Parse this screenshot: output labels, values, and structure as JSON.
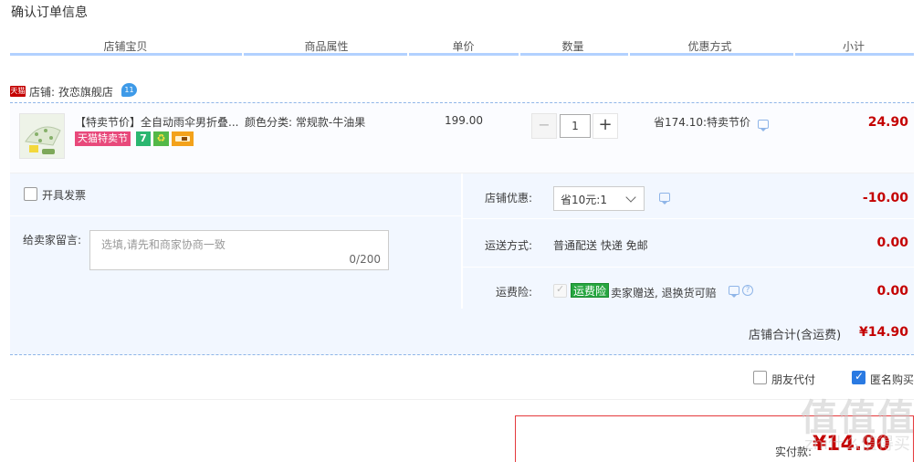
{
  "page_title": "确认订单信息",
  "columns": [
    "店铺宝贝",
    "商品属性",
    "单价",
    "数量",
    "优惠方式",
    "小计"
  ],
  "shop": {
    "badge": "天猫",
    "label": "店铺: 孜恋旗舰店",
    "chat_badge": "11"
  },
  "item": {
    "title": "【特卖节价】全自动雨伞男折叠...",
    "tag_sale": "天猫特卖节",
    "tag_seven": "7",
    "tag_shield": "♻",
    "sku": "颜色分类: 常规款-牛油果",
    "price": "199.00",
    "quantity": "1",
    "minus": "−",
    "plus": "+",
    "discount": "省174.10:特卖节价",
    "subtotal": "24.90"
  },
  "invoice": {
    "label": "开具发票"
  },
  "message": {
    "label": "给卖家留言:",
    "placeholder": "选填,请先和商家协商一致",
    "count": "0/200"
  },
  "shop_discount": {
    "label": "店铺优惠:",
    "selected": "省10元:1",
    "amount": "-10.00"
  },
  "shipping": {
    "label": "运送方式:",
    "value": "普通配送 快递 免邮",
    "amount": "0.00"
  },
  "insurance": {
    "label": "运费险:",
    "badge": "运费险",
    "value": "卖家赠送, 退换货可赔",
    "amount": "0.00"
  },
  "shop_total": {
    "label": "店铺合计(含运费)",
    "amount": "¥14.90"
  },
  "options": {
    "friend_pay": "朋友代付",
    "anonymous": "匿名购买"
  },
  "payment": {
    "label": "实付款:",
    "amount": "¥14.90"
  },
  "watermark": {
    "main": "值值值",
    "sub": "zhi什么值得买"
  },
  "colors": {
    "accent_red": "#c40000",
    "accent_blue": "#2a7ae2",
    "panel_bg": "#f2f7ff"
  }
}
